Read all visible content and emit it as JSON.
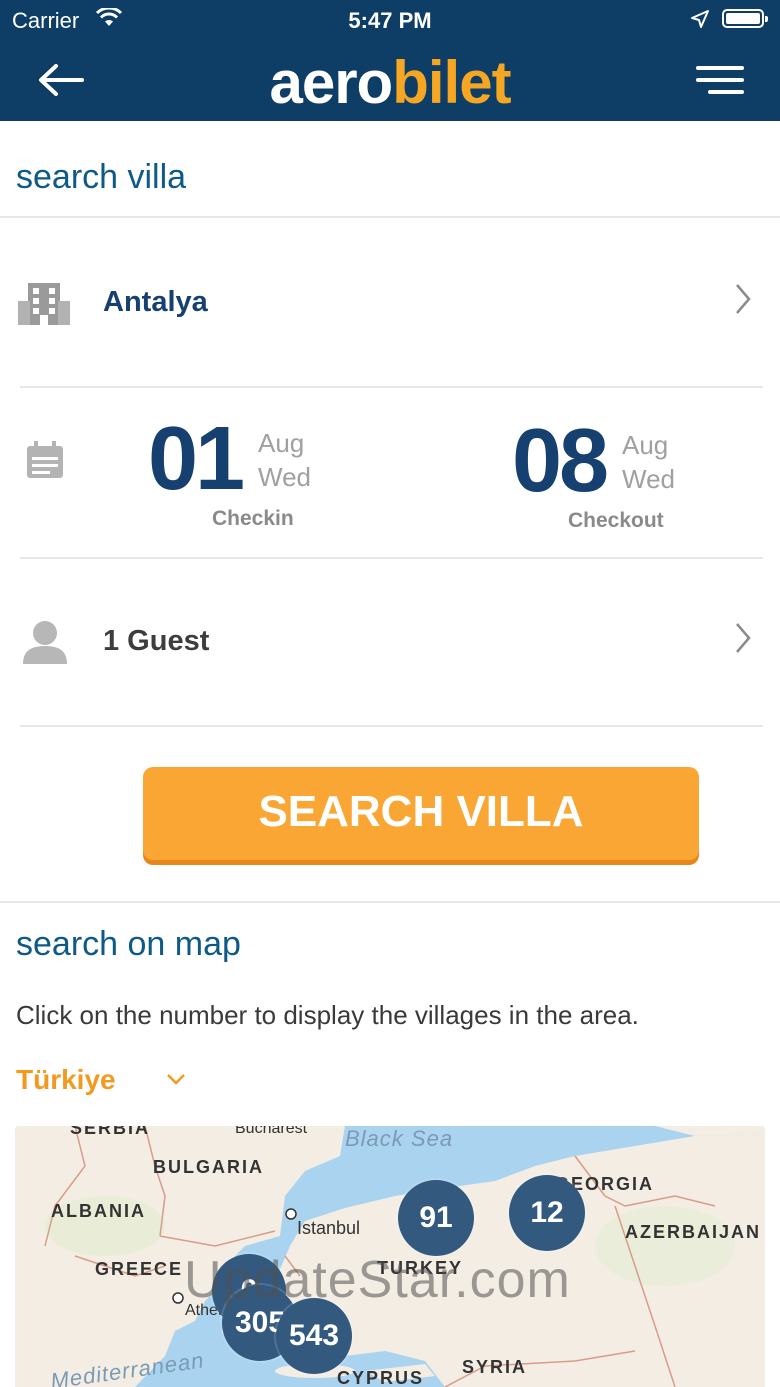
{
  "status": {
    "carrier": "Carrier",
    "time": "5:47 PM"
  },
  "header": {
    "logo_part1": "aero",
    "logo_part2": "bilet"
  },
  "search_villa": {
    "title": "search villa",
    "location": "Antalya",
    "checkin": {
      "day": "01",
      "month": "Aug",
      "weekday": "Wed",
      "label": "Checkin"
    },
    "checkout": {
      "day": "08",
      "month": "Aug",
      "weekday": "Wed",
      "label": "Checkout"
    },
    "guests": "1 Guest",
    "button": "SEARCH VILLA"
  },
  "map_section": {
    "title": "search on map",
    "hint": "Click on the number to display the villages in the area.",
    "country": "Türkiye",
    "labels": {
      "serbia": "SERBIA",
      "bucharest": "Bucharest",
      "black_sea": "Black Sea",
      "bulgaria": "BULGARIA",
      "georgia": "GEORGIA",
      "albania": "ALBANIA",
      "istanbul": "Istanbul",
      "azerbaijan": "AZERBAIJAN",
      "greece": "GREECE",
      "turkey": "TURKEY",
      "athens": "Athens",
      "mediterranean": "Mediterranean",
      "cyprus": "CYPRUS",
      "syria": "SYRIA"
    },
    "clusters": [
      {
        "count": "91"
      },
      {
        "count": "12"
      },
      {
        "count": "6"
      },
      {
        "count": "305"
      },
      {
        "count": "543"
      }
    ]
  },
  "watermark": "UpdateStar.com"
}
